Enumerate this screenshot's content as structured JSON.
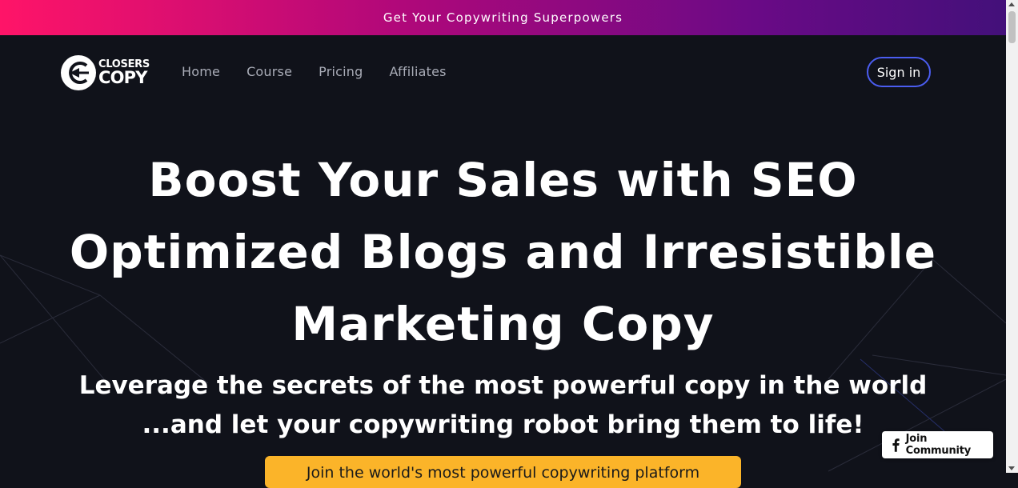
{
  "promo_bar": {
    "text": "Get Your Copywriting Superpowers"
  },
  "nav": {
    "logo": {
      "line1": "CLOSERS",
      "line2": "COPY"
    },
    "links": [
      "Home",
      "Course",
      "Pricing",
      "Affiliates"
    ],
    "signin_label": "Sign in"
  },
  "hero": {
    "title_lines": [
      "Boost Your Sales with SEO",
      "Optimized Blogs and Irresistible",
      "Marketing Copy"
    ],
    "subtitle_lines": [
      "Leverage the secrets of the most powerful copy in the world",
      "...and let your copywriting robot bring them to life!"
    ],
    "cta_label": "Join the world's most powerful copywriting platform"
  },
  "community_widget": {
    "label": "Join Community",
    "icon": "facebook-icon"
  },
  "colors": {
    "background": "#10121a",
    "promo_start": "#ff1468",
    "promo_end": "#43107a",
    "signin_border": "#4b5df0",
    "cta": "#fbb429",
    "nav_link": "#a9acb7"
  }
}
